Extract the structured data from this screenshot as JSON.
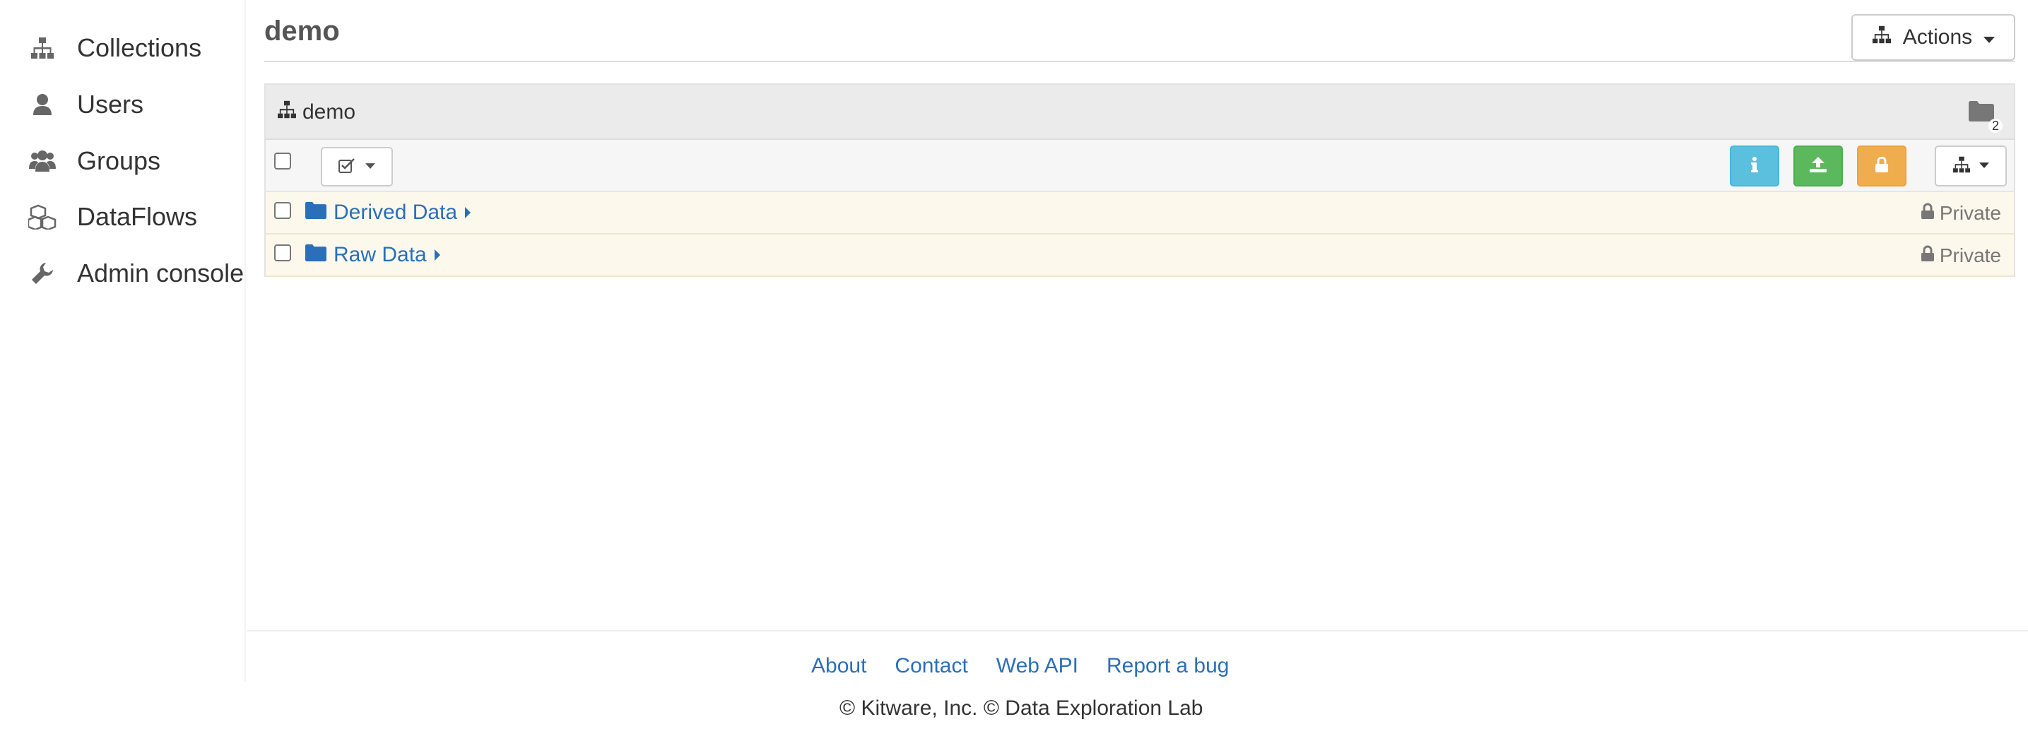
{
  "sidebar": {
    "items": [
      {
        "label": "Collections",
        "icon": "sitemap-icon"
      },
      {
        "label": "Users",
        "icon": "user-icon"
      },
      {
        "label": "Groups",
        "icon": "users-icon"
      },
      {
        "label": "DataFlows",
        "icon": "cubes-icon"
      },
      {
        "label": "Admin console",
        "icon": "wrench-icon"
      }
    ]
  },
  "header": {
    "title": "demo",
    "actions_label": "Actions"
  },
  "breadcrumb": {
    "label": "demo",
    "folder_count": "2"
  },
  "rows": [
    {
      "name": "Derived Data",
      "access": "Private"
    },
    {
      "name": "Raw Data",
      "access": "Private"
    }
  ],
  "footer": {
    "links": [
      "About",
      "Contact",
      "Web API",
      "Report a bug"
    ],
    "copyright": "© Kitware, Inc. © Data Exploration Lab"
  },
  "colors": {
    "link": "#2a6fb8",
    "info": "#5bc0de",
    "success": "#5cb85c",
    "warning": "#f0ad4e",
    "row_bg": "#fdf8ec"
  }
}
